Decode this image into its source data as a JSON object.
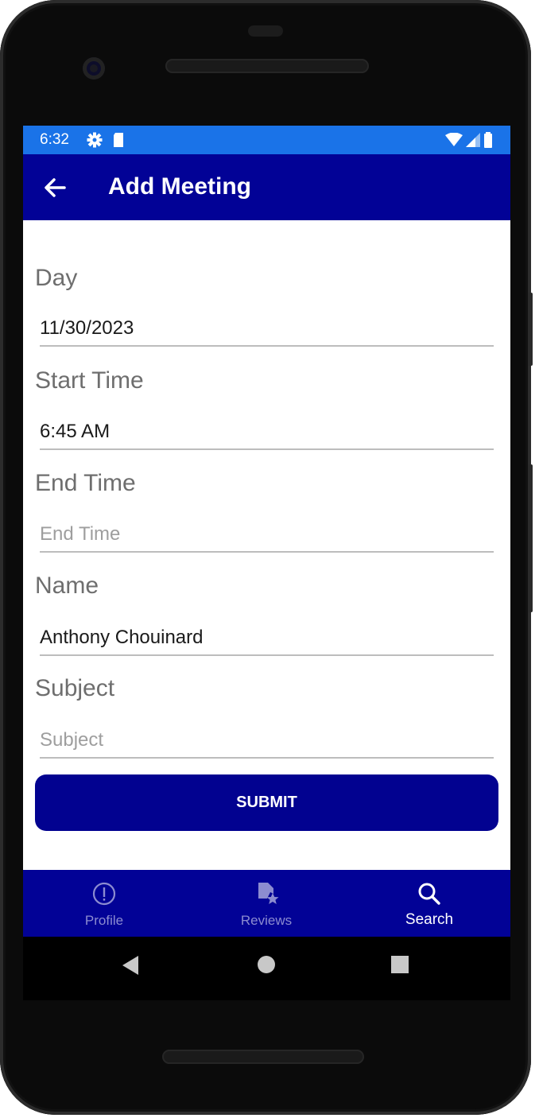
{
  "status_bar": {
    "time": "6:32",
    "icons": [
      "gear-icon",
      "sd-card-icon",
      "wifi-icon",
      "signal-icon",
      "battery-icon"
    ]
  },
  "app_bar": {
    "title": "Add Meeting",
    "back_icon": "back-arrow-icon"
  },
  "form": {
    "day": {
      "label": "Day",
      "value": "11/30/2023",
      "placeholder": ""
    },
    "start_time": {
      "label": "Start Time",
      "value": "6:45 AM",
      "placeholder": ""
    },
    "end_time": {
      "label": "End Time",
      "value": "",
      "placeholder": "End Time"
    },
    "name": {
      "label": "Name",
      "value": "Anthony Chouinard",
      "placeholder": ""
    },
    "subject": {
      "label": "Subject",
      "value": "",
      "placeholder": "Subject"
    },
    "submit_label": "SUBMIT"
  },
  "bottom_nav": {
    "items": [
      {
        "label": "Profile",
        "icon": "info-icon",
        "active": false
      },
      {
        "label": "Reviews",
        "icon": "review-document-icon",
        "active": false
      },
      {
        "label": "Search",
        "icon": "search-icon",
        "active": true
      }
    ]
  },
  "colors": {
    "status_bar": "#1a73e8",
    "primary": "#020296",
    "inactive_nav": "#8c8cd0"
  }
}
